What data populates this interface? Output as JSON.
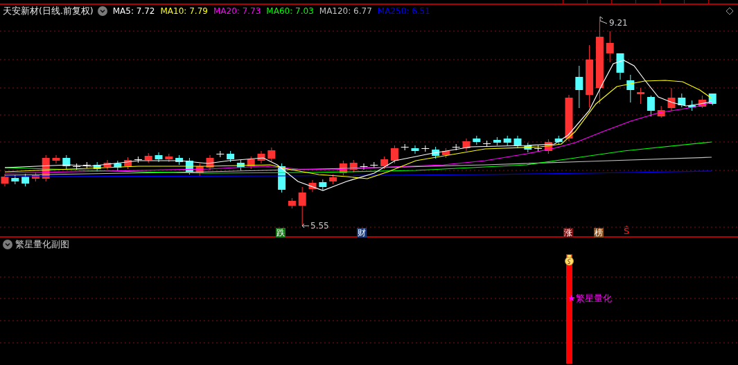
{
  "stock_header": {
    "title": "天安新材(日线.前复权)",
    "indicators": [
      {
        "label": "MA5: 7.72",
        "color": "#ffffff"
      },
      {
        "label": "MA10: 7.79",
        "color": "#ffff00"
      },
      {
        "label": "MA20: 7.73",
        "color": "#ff00ff"
      },
      {
        "label": "MA60: 7.03",
        "color": "#00ff00"
      },
      {
        "label": "MA120: 6.77",
        "color": "#c0c0c0"
      },
      {
        "label": "MA250: 6.51",
        "color": "#0000ff"
      }
    ]
  },
  "price_chart": {
    "high_label": "9.21",
    "low_label": "5.55"
  },
  "event_markers": [
    {
      "kind": "badge",
      "label": "跌",
      "color": "#137a13"
    },
    {
      "kind": "badge",
      "label": "财",
      "color": "#1b3a78"
    },
    {
      "kind": "badge",
      "label": "涨",
      "color": "#7a1010"
    },
    {
      "kind": "badge",
      "label": "榜",
      "color": "#8a4a12"
    },
    {
      "kind": "glyph",
      "label": "Ŝ",
      "color": "#ff2020"
    }
  ],
  "sub_chart": {
    "title": "繁星量化副图",
    "signal_label": "★繁星量化"
  }
}
